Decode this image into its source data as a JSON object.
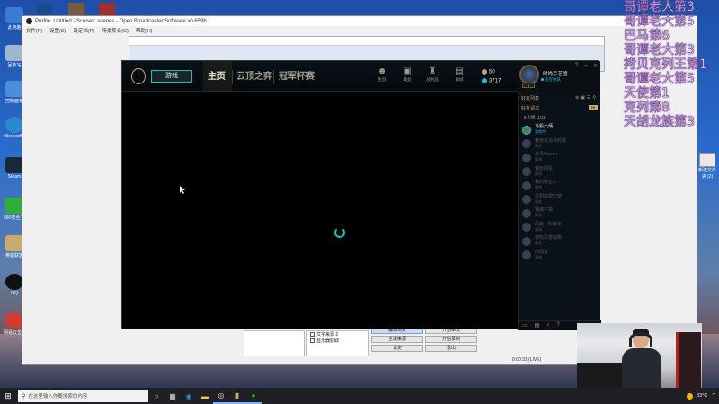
{
  "desktop": {
    "left_icons": [
      {
        "label": "此电脑",
        "color": "#3a7bd5"
      },
      {
        "label": "回收站",
        "color": "#9fb7d0"
      },
      {
        "label": "控制面板",
        "color": "#4a90d9"
      },
      {
        "label": "Microsoft Edge",
        "color": "#2a8ad0"
      },
      {
        "label": "Steam",
        "color": "#1b2838"
      },
      {
        "label": "360安全卫士",
        "color": "#2fae3a"
      },
      {
        "label": "英雄联盟",
        "color": "#c8aa6e"
      },
      {
        "label": "QQ",
        "color": "#111"
      },
      {
        "label": "网易云音乐",
        "color": "#d33a31"
      }
    ],
    "right_icons": [
      {
        "label": "新建文件夹 (2)"
      }
    ],
    "top_icons": [
      {
        "label": "",
        "color": "#1a4a8a"
      },
      {
        "label": "",
        "color": "#7a5a3a"
      },
      {
        "label": "",
        "color": "#a03030"
      }
    ]
  },
  "overlay": {
    "names": [
      "哥谭老大第3",
      "哥谭老大第5",
      "巴马第6",
      "哥谭老大第3",
      "拷贝克列王第1",
      "哥谭老大第5",
      "天使第1",
      "克列第8",
      "天胡龙族第3"
    ]
  },
  "obs": {
    "title": "Profile: Untitled - Scenes: scenes - Open Broadcaster Software v0.659b",
    "menu": [
      "文件(F)",
      "设置(S)",
      "设定档(P)",
      "场景集合(C)",
      "帮助(H)"
    ],
    "sources": [
      "文字来源 2",
      "显示器获取"
    ],
    "buttons": {
      "start_stream": "开始串流",
      "start_record": "开始录制",
      "fullscreen": "全域来源",
      "preview": "编辑场景",
      "settings": "设定",
      "exit": "退出"
    },
    "status_time": "0:00:31 (LIVE)"
  },
  "lol": {
    "play_label": "游戏",
    "tabs": [
      "主页",
      "云顶之弈",
      "冠军杯赛"
    ],
    "nav_icons": [
      {
        "name": "profile",
        "label": "生涯",
        "glyph": "☻"
      },
      {
        "name": "collection",
        "label": "藏品",
        "glyph": "▣"
      },
      {
        "name": "loot",
        "label": "战利品",
        "glyph": "♜"
      },
      {
        "name": "store",
        "label": "商城",
        "glyph": "▤"
      }
    ],
    "currency": {
      "be": "50",
      "rp": "3717"
    },
    "profile": {
      "name": "时尚手艺馆",
      "status": "正在组队",
      "level": "1"
    },
    "friends": {
      "header": "好友列表",
      "sub": "好友请求",
      "sub_badge": "99",
      "group": "▾ 小组 (1/11)",
      "list": [
        {
          "name": "马股大炳",
          "status": "游戏中",
          "online": true
        },
        {
          "name": "我自在追寻的那",
          "status": "离线",
          "online": false
        },
        {
          "name": "分号Queen",
          "status": "离线",
          "online": false
        },
        {
          "name": "我玩阿星",
          "status": "离线",
          "online": false
        },
        {
          "name": "我的秘密三",
          "status": "离线",
          "online": false
        },
        {
          "name": "黑阳的银天使",
          "status": "离线",
          "online": false
        },
        {
          "name": "独离不孤",
          "status": "离线",
          "online": false
        },
        {
          "name": "风去 - 依雨凉",
          "status": "离线",
          "online": false
        },
        {
          "name": "窗吹风雪成陈",
          "status": "离线",
          "online": false
        },
        {
          "name": "南情说",
          "status": "离线",
          "online": false
        }
      ]
    }
  },
  "taskbar": {
    "search_placeholder": "在这里输入你要搜索的内容",
    "weather": "33°C",
    "apps": [
      "task-view",
      "edge",
      "file-explorer",
      "obs",
      "lol",
      "360"
    ]
  }
}
